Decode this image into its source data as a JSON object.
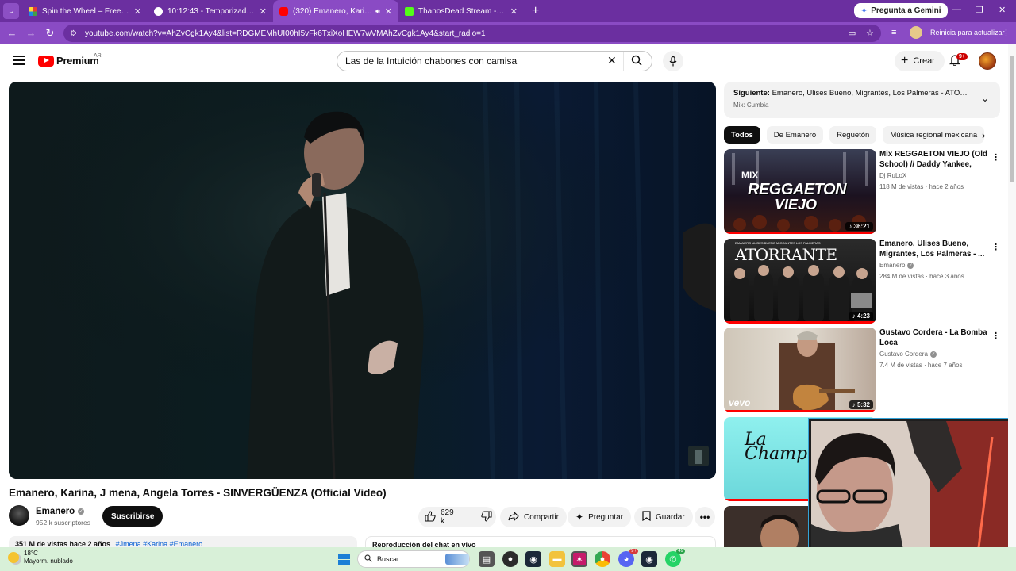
{
  "browser": {
    "tabs": [
      {
        "title": "Spin the Wheel – Free Wheel Sp",
        "favicon_color": "#e7b22a",
        "active": false
      },
      {
        "title": "10:12:43 - Temporizador Online",
        "favicon_color": "#ffffff",
        "active": false
      },
      {
        "title": "(320) Emanero, Karina, J me",
        "favicon_color": "#ff0000",
        "active": true
      },
      {
        "title": "ThanosDead Stream - Watch Li",
        "favicon_color": "#53fc18",
        "active": false
      }
    ],
    "gemini_label": "Pregunta a Gemini",
    "url": "youtube.com/watch?v=AhZvCgk1Ay4&list=RDGMEMhUI00hI5vFk6TxiXoHEW7wVMAhZvCgk1Ay4&start_radio=1",
    "restart_label": "Reinicia para actualizar",
    "accent_color": "#6b2fa0"
  },
  "youtube": {
    "brand": "Premium",
    "region": "AR",
    "search_query": "Las de la Intuición chabones con camisa",
    "create_label": "Crear",
    "notif_count": "9+"
  },
  "video": {
    "title": "Emanero, Karina, J mena, Angela Torres - SINVERGÜENZA (Official Video)",
    "channel": "Emanero",
    "subscribers": "952 k suscriptores",
    "subscribe_label": "Suscribirse",
    "likes": "629 k",
    "share_label": "Compartir",
    "ask_label": "Preguntar",
    "save_label": "Guardar",
    "description_meta": "351 M de vistas  hace 2 años",
    "description_tags": "#Jmena #Karina #Emanero",
    "chat_replay_label": "Reproducción del chat en vivo"
  },
  "sidebar": {
    "up_next_prefix": "Siguiente:",
    "up_next_title": "Emanero, Ulises Bueno, Migrantes, Los Palmeras - ATORRA...",
    "up_next_sub": "Mix: Cumbia",
    "chips": [
      "Todos",
      "De Emanero",
      "Reguetón",
      "Música regional mexicana"
    ],
    "recommendations": [
      {
        "title": "Mix REGGAETON VIEJO (Old School) // Daddy Yankee, Plan ...",
        "channel": "Dj RuLoX",
        "verified": false,
        "meta": "118 M de vistas · hace 2 años",
        "duration": "36:21",
        "thumb_text_1": "MIX",
        "thumb_text_2": "REGGAETON",
        "thumb_text_3": "VIEJO"
      },
      {
        "title": "Emanero, Ulises Bueno, Migrantes, Los Palmeras - ...",
        "channel": "Emanero",
        "verified": true,
        "meta": "284 M de vistas · hace 3 años",
        "duration": "4:23",
        "thumb_text_1": "ATORRANTE",
        "thumb_text_2": "EMANERO  ULISES BUENO  MIGRANTES  LOS PALMERAS"
      },
      {
        "title": "Gustavo Cordera - La Bomba Loca",
        "channel": "Gustavo Cordera",
        "verified": true,
        "meta": "7.4 M de vistas · hace 7 años",
        "duration": "5:32",
        "thumb_text_1": "vevo"
      }
    ],
    "partial_thumb_text": "La Champ"
  },
  "taskbar": {
    "temperature": "18°C",
    "weather": "Mayorm. nublado",
    "search_placeholder": "Buscar",
    "discord_badge": "9+",
    "whatsapp_badge": "49"
  }
}
